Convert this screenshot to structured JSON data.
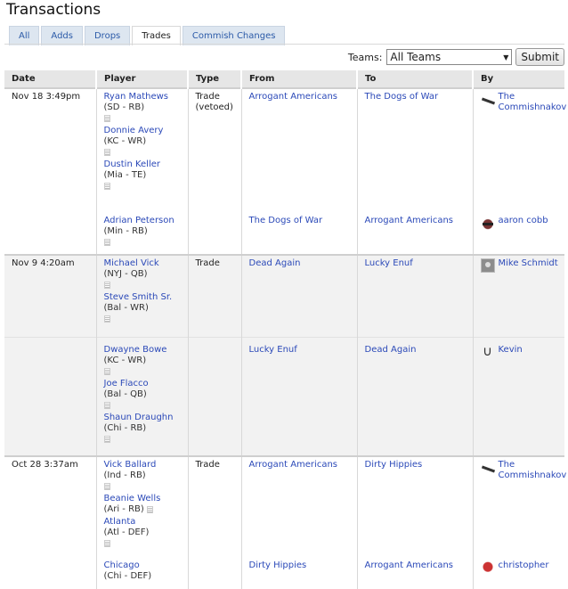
{
  "page": {
    "title": "Transactions"
  },
  "tabs": [
    {
      "label": "All"
    },
    {
      "label": "Adds"
    },
    {
      "label": "Drops"
    },
    {
      "label": "Trades"
    },
    {
      "label": "Commish Changes"
    }
  ],
  "toolbar": {
    "teams_label": "Teams:",
    "teams_value": "All Teams",
    "submit_label": "Submit"
  },
  "columns": {
    "date": "Date",
    "player": "Player",
    "type": "Type",
    "from": "From",
    "to": "To",
    "by": "By"
  },
  "rows": [
    {
      "date": "Nov 18 3:49pm",
      "type": "Trade (vetoed)",
      "players": [
        {
          "name": "Ryan Mathews",
          "pos": "(SD - RB)"
        },
        {
          "name": "Donnie Avery",
          "pos": "(KC - WR)"
        },
        {
          "name": "Dustin Keller",
          "pos": "(Mia - TE)"
        }
      ],
      "from": "Arrogant Americans",
      "to": "The Dogs of War",
      "by": "The Commishnakov"
    },
    {
      "players": [
        {
          "name": "Adrian Peterson",
          "pos": "(Min - RB)"
        }
      ],
      "from": "The Dogs of War",
      "to": "Arrogant Americans",
      "by": "aaron cobb"
    },
    {
      "date": "Nov 9 4:20am",
      "type": "Trade",
      "players": [
        {
          "name": "Michael Vick",
          "pos": "(NYJ - QB)"
        },
        {
          "name": "Steve Smith Sr.",
          "pos": "(Bal - WR)"
        }
      ],
      "from": "Dead Again",
      "to": "Lucky Enuf",
      "by": "Mike Schmidt"
    },
    {
      "players": [
        {
          "name": "Dwayne Bowe",
          "pos": "(KC - WR)"
        },
        {
          "name": "Joe Flacco",
          "pos": "(Bal - QB)"
        },
        {
          "name": "Shaun Draughn",
          "pos": "(Chi - RB)"
        }
      ],
      "from": "Lucky Enuf",
      "to": "Dead Again",
      "by": "Kevin"
    },
    {
      "date": "Oct 28 3:37am",
      "type": "Trade",
      "players": [
        {
          "name": "Vick Ballard",
          "pos": "(Ind - RB)"
        },
        {
          "name": "Beanie Wells",
          "pos": "(Ari - RB)"
        },
        {
          "name": "Atlanta",
          "pos": "(Atl - DEF)"
        }
      ],
      "from": "Arrogant Americans",
      "to": "Dirty Hippies",
      "by": "The Commishnakov"
    },
    {
      "players": [
        {
          "name": "Chicago",
          "pos": "(Chi - DEF)"
        }
      ],
      "from": "Dirty Hippies",
      "to": "Arrogant Americans",
      "by": "christopher"
    }
  ]
}
